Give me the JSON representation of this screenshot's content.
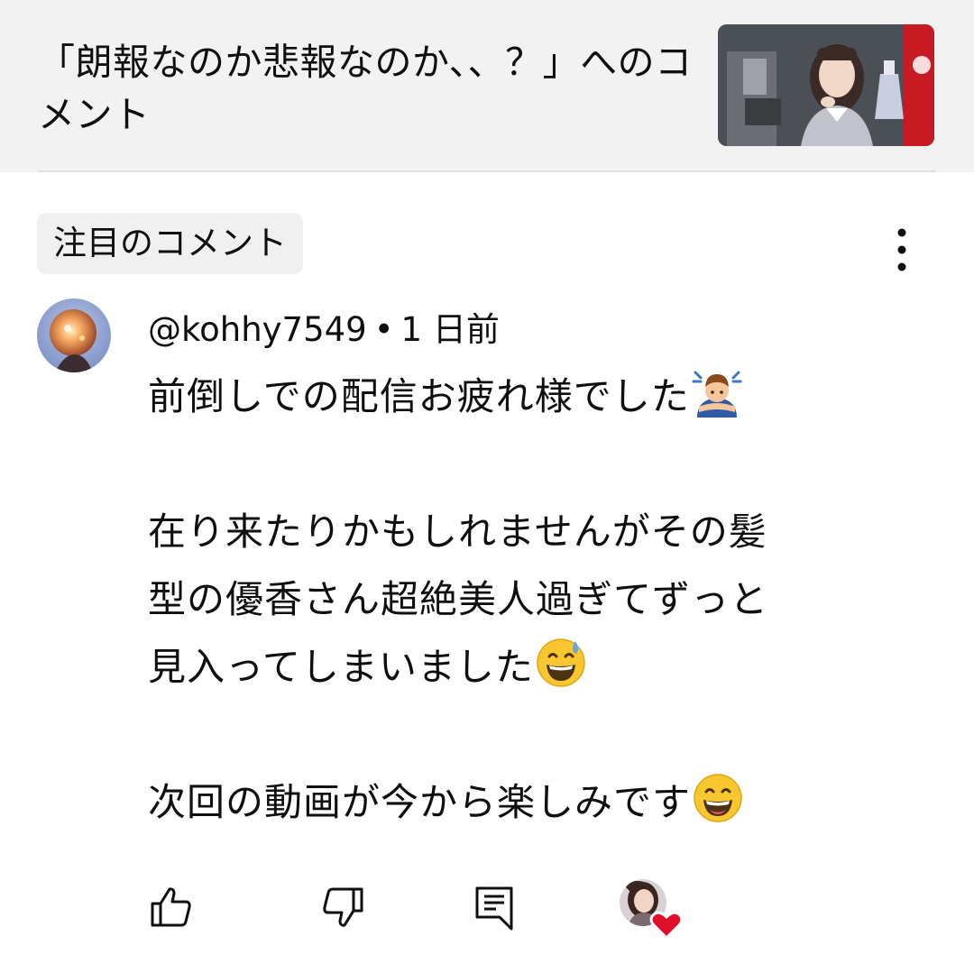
{
  "header": {
    "title": "「朗報なのか悲報なのか、、？」へのコメント",
    "thumbnail_icon": "video-thumbnail"
  },
  "comments_section": {
    "chip_label": "注目のコメント",
    "menu_icon": "more-vertical-icon"
  },
  "comment": {
    "author": "@kohhy7549",
    "separator": "•",
    "time_ago": "1 日前",
    "lines": [
      "前倒しでの配信お疲れ様でした",
      "",
      "在り来たりかもしれませんがその髪",
      "型の優香さん超絶美人過ぎてずっと",
      "見入ってしまいました",
      "",
      "次回の動画が今から楽しみです"
    ],
    "line_emojis": [
      "person-bowing-emoji",
      "",
      "",
      "",
      "grinning-sweat-emoji",
      "",
      "grinning-face-emoji"
    ]
  },
  "actions": {
    "like_icon": "thumbs-up-icon",
    "dislike_icon": "thumbs-down-icon",
    "reply_icon": "reply-icon",
    "creator_heart_icon": "creator-heart-icon"
  },
  "colors": {
    "header_bg": "#f2f2f2",
    "chip_bg": "#f0f0f0",
    "text": "#0f0f0f",
    "heart": "#e0102a"
  }
}
